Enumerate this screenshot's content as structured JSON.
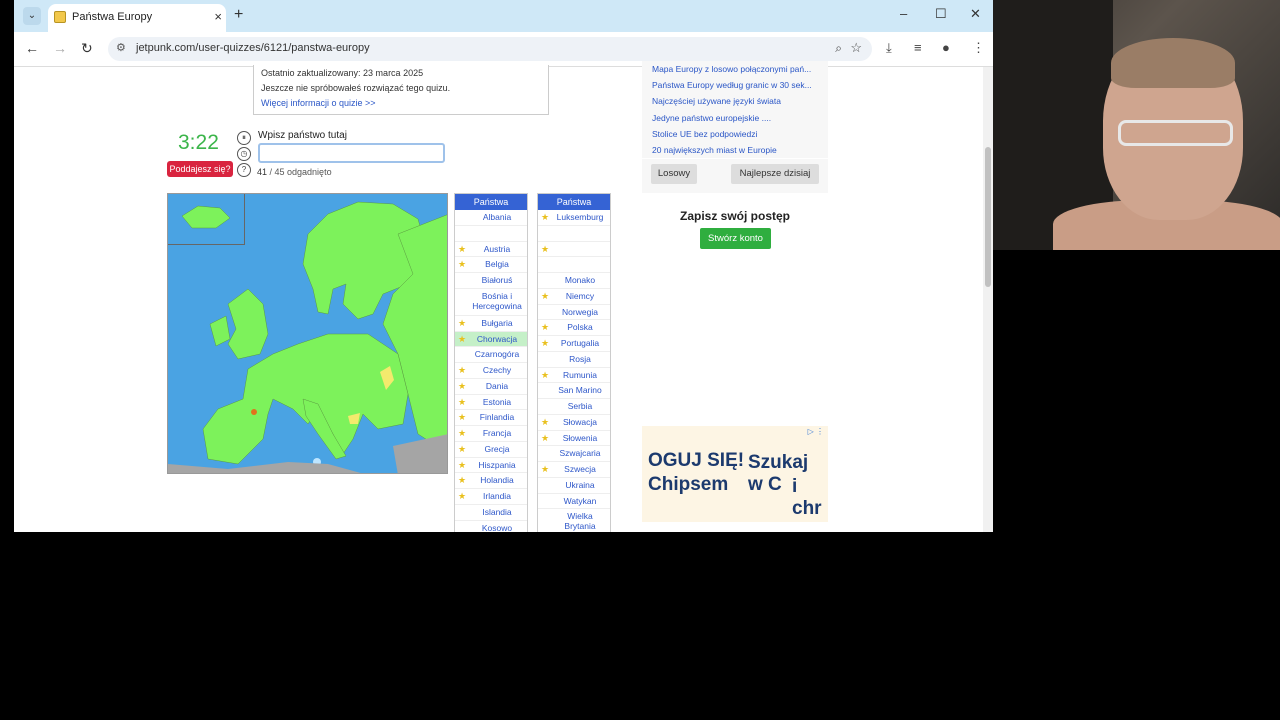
{
  "browser": {
    "tab_title": "Państwa Europy",
    "url": "jetpunk.com/user-quizzes/6121/panstwa-europy"
  },
  "info_box": {
    "updated": "Ostatnio zaktualizowany: 23 marca 2025",
    "not_tried": "Jeszcze nie spróbowałeś rozwiązać tego quizu.",
    "more_info": "Więcej informacji o quizie >>"
  },
  "quiz": {
    "timer": "3:22",
    "give_up": "Poddajesz się?",
    "prompt": "Wpisz państwo tutaj",
    "input_value": "",
    "score_count": "41",
    "score_rest": " / 45 odgadnięto"
  },
  "table_header": "Państwa",
  "table_left": [
    {
      "name": "Albania",
      "star": false,
      "hl": false
    },
    {
      "name": "",
      "star": false,
      "hl": false
    },
    {
      "name": "Austria",
      "star": true,
      "hl": false
    },
    {
      "name": "Belgia",
      "star": true,
      "hl": false
    },
    {
      "name": "Białoruś",
      "star": false,
      "hl": false
    },
    {
      "name": "Bośnia i Hercegowina",
      "star": false,
      "hl": false,
      "tall": true
    },
    {
      "name": "Bułgaria",
      "star": true,
      "hl": false
    },
    {
      "name": "Chorwacja",
      "star": true,
      "hl": true
    },
    {
      "name": "Czarnogóra",
      "star": false,
      "hl": false
    },
    {
      "name": "Czechy",
      "star": true,
      "hl": false
    },
    {
      "name": "Dania",
      "star": true,
      "hl": false
    },
    {
      "name": "Estonia",
      "star": true,
      "hl": false
    },
    {
      "name": "Finlandia",
      "star": true,
      "hl": false
    },
    {
      "name": "Francja",
      "star": true,
      "hl": false
    },
    {
      "name": "Grecja",
      "star": true,
      "hl": false
    },
    {
      "name": "Hiszpania",
      "star": true,
      "hl": false
    },
    {
      "name": "Holandia",
      "star": true,
      "hl": false
    },
    {
      "name": "Irlandia",
      "star": true,
      "hl": false
    },
    {
      "name": "Islandia",
      "star": false,
      "hl": false
    },
    {
      "name": "Kosowo",
      "star": false,
      "hl": false
    }
  ],
  "table_right": [
    {
      "name": "Luksemburg",
      "star": true,
      "hl": false
    },
    {
      "name": "",
      "star": false,
      "hl": false
    },
    {
      "name": "",
      "star": true,
      "hl": false
    },
    {
      "name": "",
      "star": false,
      "hl": false
    },
    {
      "name": "Monako",
      "star": false,
      "hl": false
    },
    {
      "name": "Niemcy",
      "star": true,
      "hl": false
    },
    {
      "name": "Norwegia",
      "star": false,
      "hl": false
    },
    {
      "name": "Polska",
      "star": true,
      "hl": false
    },
    {
      "name": "Portugalia",
      "star": true,
      "hl": false
    },
    {
      "name": "Rosja",
      "star": false,
      "hl": false
    },
    {
      "name": "Rumunia",
      "star": true,
      "hl": false
    },
    {
      "name": "San Marino",
      "star": false,
      "hl": false
    },
    {
      "name": "Serbia",
      "star": false,
      "hl": false
    },
    {
      "name": "Słowacja",
      "star": true,
      "hl": false
    },
    {
      "name": "Słowenia",
      "star": true,
      "hl": false
    },
    {
      "name": "Szwajcaria",
      "star": false,
      "hl": false
    },
    {
      "name": "Szwecja",
      "star": true,
      "hl": false
    },
    {
      "name": "Ukraina",
      "star": false,
      "hl": false
    },
    {
      "name": "Watykan",
      "star": false,
      "hl": false
    },
    {
      "name": "Wielka Brytania",
      "star": false,
      "hl": false,
      "tall": true
    }
  ],
  "sidebar": {
    "links": [
      "Mapa Europy z losowo połączonymi pań...",
      "Państwa Europy według granic w 30 sek...",
      "Najczęściej używane języki świata",
      "Jedyne państwo europejskie ....",
      "Stolice UE bez podpowiedzi",
      "20 największych miast w Europie"
    ],
    "random_btn": "Losowy",
    "best_today_btn": "Najlepsze dzisiaj",
    "save_title": "Zapisz swój postęp",
    "create_account_btn": "Stwórz konto"
  },
  "ad": {
    "line1": "OGUJ SIĘ!",
    "line2": "Chipsem",
    "line3": "Szukaj w C",
    "line4": "i chr"
  },
  "colors": {
    "timer": "#3bb54a",
    "give_up": "#d9243f",
    "table_header": "#3563d4",
    "create_account": "#2fae3f",
    "map_water": "#4aa3e3",
    "map_land": "#7df25b"
  }
}
